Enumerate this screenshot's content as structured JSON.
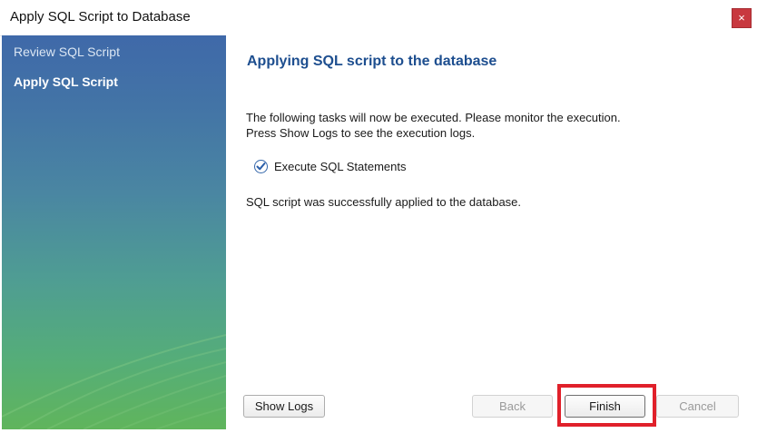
{
  "window": {
    "title": "Apply SQL Script to Database",
    "close_label": "×"
  },
  "sidebar": {
    "steps": [
      {
        "label": "Review SQL Script",
        "active": false
      },
      {
        "label": "Apply SQL Script",
        "active": true
      }
    ]
  },
  "main": {
    "heading": "Applying SQL script to the database",
    "description_line1": "The following tasks will now be executed. Please monitor the execution.",
    "description_line2": "Press Show Logs to see the execution logs.",
    "task": {
      "label": "Execute SQL Statements",
      "status": "done",
      "icon": "check-circle-icon"
    },
    "result": "SQL script was successfully applied to the database."
  },
  "buttons": {
    "show_logs": "Show Logs",
    "back": "Back",
    "finish": "Finish",
    "cancel": "Cancel"
  },
  "colors": {
    "heading": "#1d4e8f",
    "highlight": "#e0202a",
    "close": "#c8383f"
  }
}
